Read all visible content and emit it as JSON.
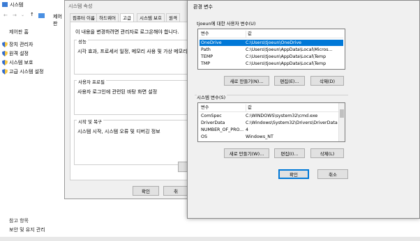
{
  "control_panel": {
    "title": "시스템",
    "home": "제어판 홈",
    "path": "제어판",
    "links": [
      "장치 관리자",
      "원격 설정",
      "시스템 보호",
      "고급 시스템 설정"
    ],
    "see_also": "참고 항목",
    "security": "보안 및 유지 관리"
  },
  "system_properties": {
    "title": "시스템 속성",
    "tabs": [
      "컴퓨터 이름",
      "하드웨어",
      "고급",
      "시스템 보호",
      "원격"
    ],
    "notice": "이 내용을 변경하려면 관리자로 로그온해야 합니다.",
    "performance_title": "성능",
    "performance_desc": "시각 효과, 프로세서 일정, 메모리 사용 및 가상 메모리",
    "profile_title": "사용자 프로필",
    "profile_desc": "사용자 로그인에 관련된 바탕 화면 설정",
    "startup_title": "시작 및 복구",
    "startup_desc": "시스템 시작, 시스템 오류 및 디버깅 정보",
    "ok": "확인",
    "cancel": "취"
  },
  "env_dialog": {
    "title": "환경 변수",
    "user_group": "tjoeun에 대한 사용자 변수(U)",
    "user_headers": [
      "변수",
      "값"
    ],
    "user_vars": [
      {
        "name": "OneDrive",
        "value": "C:\\Users\\tjoeun\\OneDrive"
      },
      {
        "name": "Path",
        "value": "C:\\Users\\tjoeun\\AppData\\Local\\Micros..."
      },
      {
        "name": "TEMP",
        "value": "C:\\Users\\tjoeun\\AppData\\Local\\Temp"
      },
      {
        "name": "TMP",
        "value": "C:\\Users\\tjoeun\\AppData\\Local\\Temp"
      }
    ],
    "user_new": "새로 만들기(N)...",
    "user_edit": "편집(E)...",
    "user_delete": "삭제(D)",
    "system_group": "시스템 변수(S)",
    "system_headers": [
      "변수",
      "값"
    ],
    "system_vars": [
      {
        "name": "ComSpec",
        "value": "C:\\WINDOWS\\system32\\cmd.exe"
      },
      {
        "name": "DriverData",
        "value": "C:\\Windows\\System32\\Drivers\\DriverData"
      },
      {
        "name": "NUMBER_OF_PRO...",
        "value": "4"
      },
      {
        "name": "OS",
        "value": "Windows_NT"
      }
    ],
    "sys_new": "새로 만들기(W)...",
    "sys_edit": "편집(I)...",
    "sys_delete": "삭제(L)",
    "ok": "확인",
    "cancel": "취소"
  },
  "colors": {
    "selection": "#0078d7",
    "dialog_bg": "#f0f0f0"
  }
}
